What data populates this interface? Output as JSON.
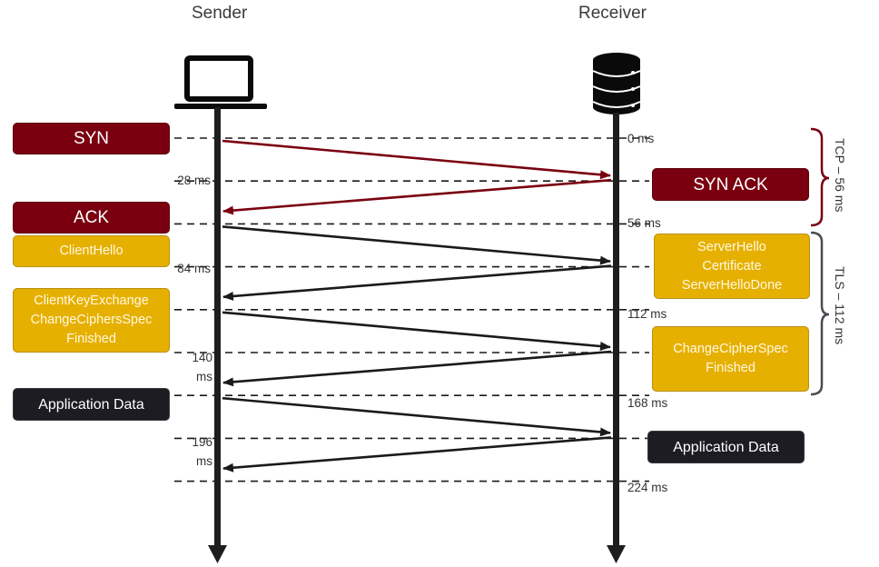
{
  "actors": {
    "sender": {
      "title": "Sender",
      "icon": "laptop-icon"
    },
    "receiver": {
      "title": "Receiver",
      "icon": "database-server-icon"
    }
  },
  "colors": {
    "tcp": "#7a0010",
    "tls": "#e6b000",
    "app": "#1c1c22",
    "arrow_tcp": "#7a0010",
    "arrow_default": "#1a1a1a",
    "brace_tcp": "#7a0010",
    "brace_tls": "#4a4a52"
  },
  "sender_messages": [
    {
      "id": "syn",
      "label": [
        "SYN"
      ],
      "style": "red"
    },
    {
      "id": "ack",
      "label": [
        "ACK"
      ],
      "style": "red"
    },
    {
      "id": "client-hello",
      "label": [
        "ClientHello"
      ],
      "style": "gold"
    },
    {
      "id": "client-key-exchange",
      "label": [
        "ClientKeyExchange",
        "ChangeCiphersSpec",
        "Finished"
      ],
      "style": "gold"
    },
    {
      "id": "sender-app-data",
      "label": [
        "Application Data"
      ],
      "style": "dark"
    }
  ],
  "receiver_messages": [
    {
      "id": "syn-ack",
      "label": [
        "SYN ACK"
      ],
      "style": "red"
    },
    {
      "id": "server-hello",
      "label": [
        "ServerHello",
        "Certificate",
        "ServerHelloDone"
      ],
      "style": "gold"
    },
    {
      "id": "change-cipher-spec",
      "label": [
        "ChangeCipherSpec",
        "Finished"
      ],
      "style": "gold"
    },
    {
      "id": "receiver-app-data",
      "label": [
        "Application Data"
      ],
      "style": "dark"
    }
  ],
  "timestamps_receiver_side": [
    "0 ms",
    "56 ms",
    "112 ms",
    "168 ms",
    "224 ms"
  ],
  "timestamps_sender_side": [
    "28 ms",
    "84 ms",
    "140 ms",
    "196 ms"
  ],
  "timestamps_sender_side_split": [
    [
      "140",
      "ms"
    ],
    [
      "196",
      "ms"
    ]
  ],
  "phases": [
    {
      "name": "TCP",
      "label": "TCP – 56 ms"
    },
    {
      "name": "TLS",
      "label": "TLS – 112 ms"
    }
  ],
  "arrows": [
    {
      "from": "sender",
      "to": "receiver",
      "t_start_ms": 0,
      "t_end_ms": 28,
      "phase": "TCP"
    },
    {
      "from": "receiver",
      "to": "sender",
      "t_start_ms": 28,
      "t_end_ms": 56,
      "phase": "TCP"
    },
    {
      "from": "sender",
      "to": "receiver",
      "t_start_ms": 56,
      "t_end_ms": 84,
      "phase": "TLS"
    },
    {
      "from": "receiver",
      "to": "sender",
      "t_start_ms": 84,
      "t_end_ms": 112,
      "phase": "TLS"
    },
    {
      "from": "sender",
      "to": "receiver",
      "t_start_ms": 112,
      "t_end_ms": 140,
      "phase": "TLS"
    },
    {
      "from": "receiver",
      "to": "sender",
      "t_start_ms": 140,
      "t_end_ms": 168,
      "phase": "TLS"
    },
    {
      "from": "sender",
      "to": "receiver",
      "t_start_ms": 168,
      "t_end_ms": 196,
      "phase": "APP"
    },
    {
      "from": "receiver",
      "to": "sender",
      "t_start_ms": 196,
      "t_end_ms": 224,
      "phase": "APP"
    }
  ]
}
